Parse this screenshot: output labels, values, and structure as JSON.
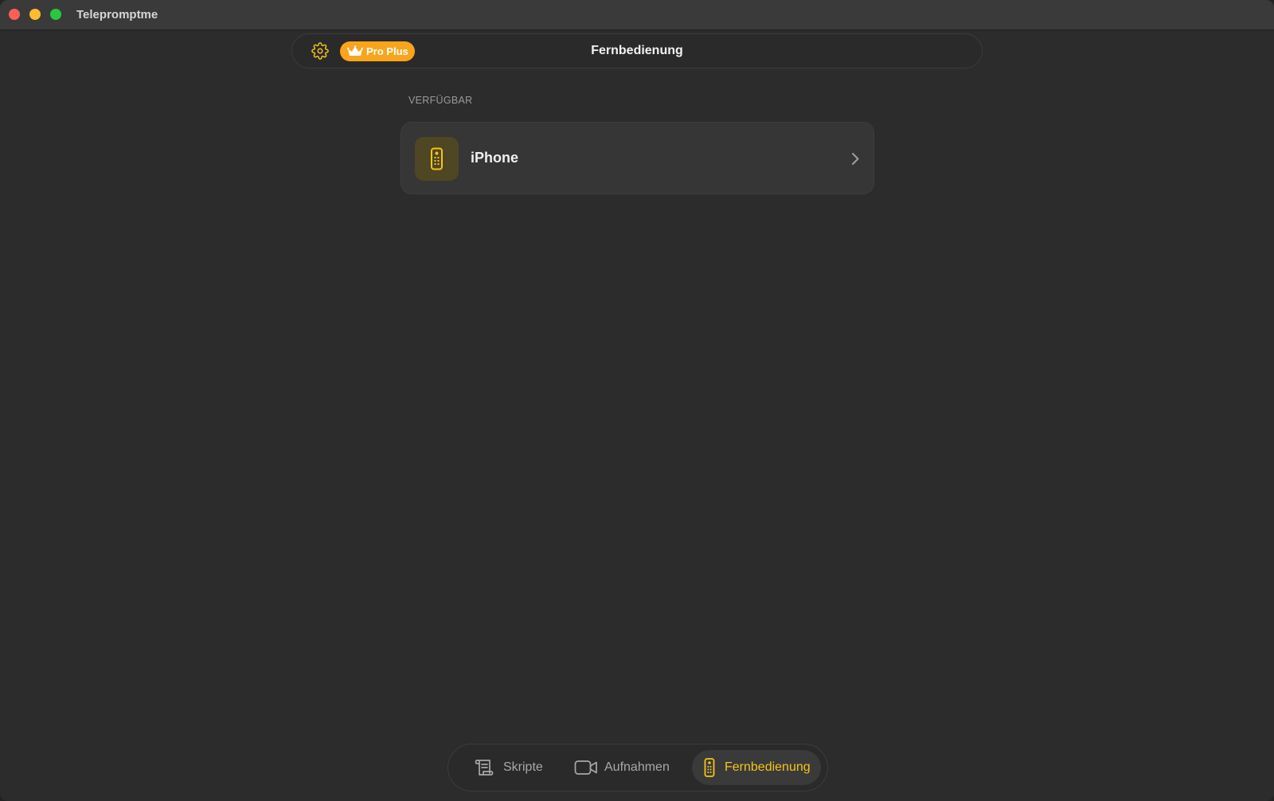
{
  "window": {
    "app_title": "Telepromptme"
  },
  "header": {
    "badge_label": "Pro Plus",
    "title": "Fernbedienung",
    "settings_icon": "gear-icon",
    "badge_icon": "crown-icon"
  },
  "section": {
    "label": "VERFÜGBAR"
  },
  "devices": [
    {
      "name": "iPhone",
      "icon": "remote-control-icon"
    }
  ],
  "tabs": [
    {
      "label": "Skripte",
      "icon": "script-icon",
      "selected": false
    },
    {
      "label": "Aufnahmen",
      "icon": "video-camera-icon",
      "selected": false
    },
    {
      "label": "Fernbedienung",
      "icon": "remote-control-icon",
      "selected": true
    }
  ],
  "colors": {
    "accent": "#f5c518",
    "badge": "#f8a51c",
    "background": "#2c2c2c",
    "card": "#363636"
  }
}
